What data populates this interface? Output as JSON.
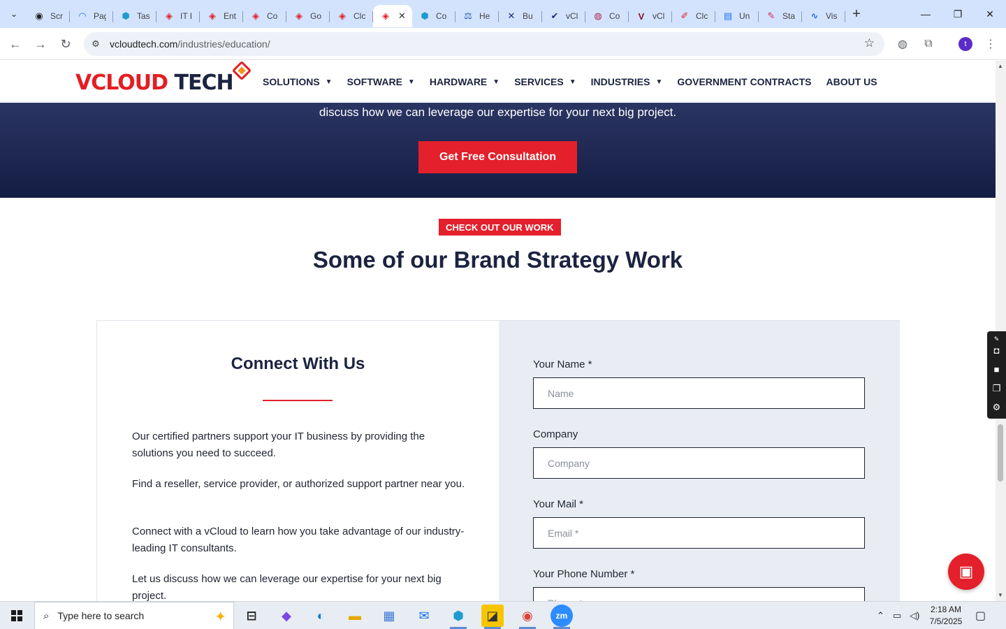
{
  "browser": {
    "tabs": [
      {
        "label": "Scr",
        "icon": "github-icon",
        "color": "#1f1f1f",
        "glyph": "◉"
      },
      {
        "label": "Pag",
        "icon": "gauge-icon",
        "color": "#1a73e8",
        "glyph": "◠"
      },
      {
        "label": "Tas",
        "icon": "hexagon-icon",
        "color": "#1d9bd1",
        "glyph": "⬢"
      },
      {
        "label": "IT I",
        "icon": "vcloud-icon",
        "color": "#e3202b",
        "glyph": "◈"
      },
      {
        "label": "Ent",
        "icon": "vcloud-icon",
        "color": "#e3202b",
        "glyph": "◈"
      },
      {
        "label": "Co",
        "icon": "vcloud-icon",
        "color": "#e3202b",
        "glyph": "◈"
      },
      {
        "label": "Go",
        "icon": "vcloud-icon",
        "color": "#e3202b",
        "glyph": "◈"
      },
      {
        "label": "Clc",
        "icon": "vcloud-icon",
        "color": "#e3202b",
        "glyph": "◈"
      },
      {
        "label": "",
        "icon": "vcloud-icon",
        "color": "#e3202b",
        "glyph": "◈",
        "active": true
      },
      {
        "label": "Co",
        "icon": "hexagon-icon",
        "color": "#1d9bd1",
        "glyph": "⬢"
      },
      {
        "label": "He",
        "icon": "scale-icon",
        "color": "#1a5fb4",
        "glyph": "⚖"
      },
      {
        "label": "Bu",
        "icon": "x-icon",
        "color": "#1a2b8a",
        "glyph": "✕"
      },
      {
        "label": "vCl",
        "icon": "check-icon",
        "color": "#1a2b8a",
        "glyph": "✔"
      },
      {
        "label": "Co",
        "icon": "ball-icon",
        "color": "#b02050",
        "glyph": "◍"
      },
      {
        "label": "vCl",
        "icon": "v-icon",
        "color": "#8a1030",
        "glyph": "V"
      },
      {
        "label": "Clc",
        "icon": "pen-icon",
        "color": "#e3202b",
        "glyph": "✐"
      },
      {
        "label": "Un",
        "icon": "doc-icon",
        "color": "#1a73e8",
        "glyph": "▤"
      },
      {
        "label": "Sta",
        "icon": "brush-icon",
        "color": "#d81b60",
        "glyph": "✎"
      },
      {
        "label": "Vis",
        "icon": "pulse-icon",
        "color": "#1a73e8",
        "glyph": "∿"
      }
    ],
    "url_host": "vcloudtech.com",
    "url_path": "/industries/education/",
    "profile_initial": "t"
  },
  "site": {
    "logo": {
      "v": "V",
      "cloud": "CLOUD",
      "tech": " TECH"
    },
    "nav": [
      {
        "label": "SOLUTIONS",
        "dropdown": true
      },
      {
        "label": "SOFTWARE",
        "dropdown": true
      },
      {
        "label": "HARDWARE",
        "dropdown": true
      },
      {
        "label": "SERVICES",
        "dropdown": true
      },
      {
        "label": "INDUSTRIES",
        "dropdown": true
      },
      {
        "label": "GOVERNMENT CONTRACTS",
        "dropdown": false
      },
      {
        "label": "ABOUT US",
        "dropdown": false
      }
    ],
    "hero_text": "discuss how we can leverage our expertise for your next big project.",
    "cta_label": "Get Free Consultation",
    "work_badge": "CHECK OUT OUR WORK",
    "work_title": "Some of our Brand Strategy Work",
    "connect": {
      "title": "Connect With Us",
      "paragraphs": [
        "Our certified partners support your IT business by providing the solutions you need to succeed.",
        "Find a reseller, service provider, or authorized support partner near you.",
        "Connect with a vCloud to learn how you take advantage of our industry-leading IT consultants.",
        "Let us discuss how we can leverage our expertise for your next big project."
      ]
    },
    "form": {
      "name_label": "Your Name *",
      "name_placeholder": "Name",
      "company_label": "Company",
      "company_placeholder": "Company",
      "mail_label": "Your Mail *",
      "mail_placeholder": "Email *",
      "phone_label": "Your Phone Number *",
      "phone_placeholder": "Phone *"
    }
  },
  "taskbar": {
    "search_placeholder": "Type here to search",
    "time": "2:18 AM",
    "date": "7/5/2025",
    "zoom_label": "zm"
  },
  "colors": {
    "accent_red": "#e3202b",
    "navy": "#1b2340"
  }
}
